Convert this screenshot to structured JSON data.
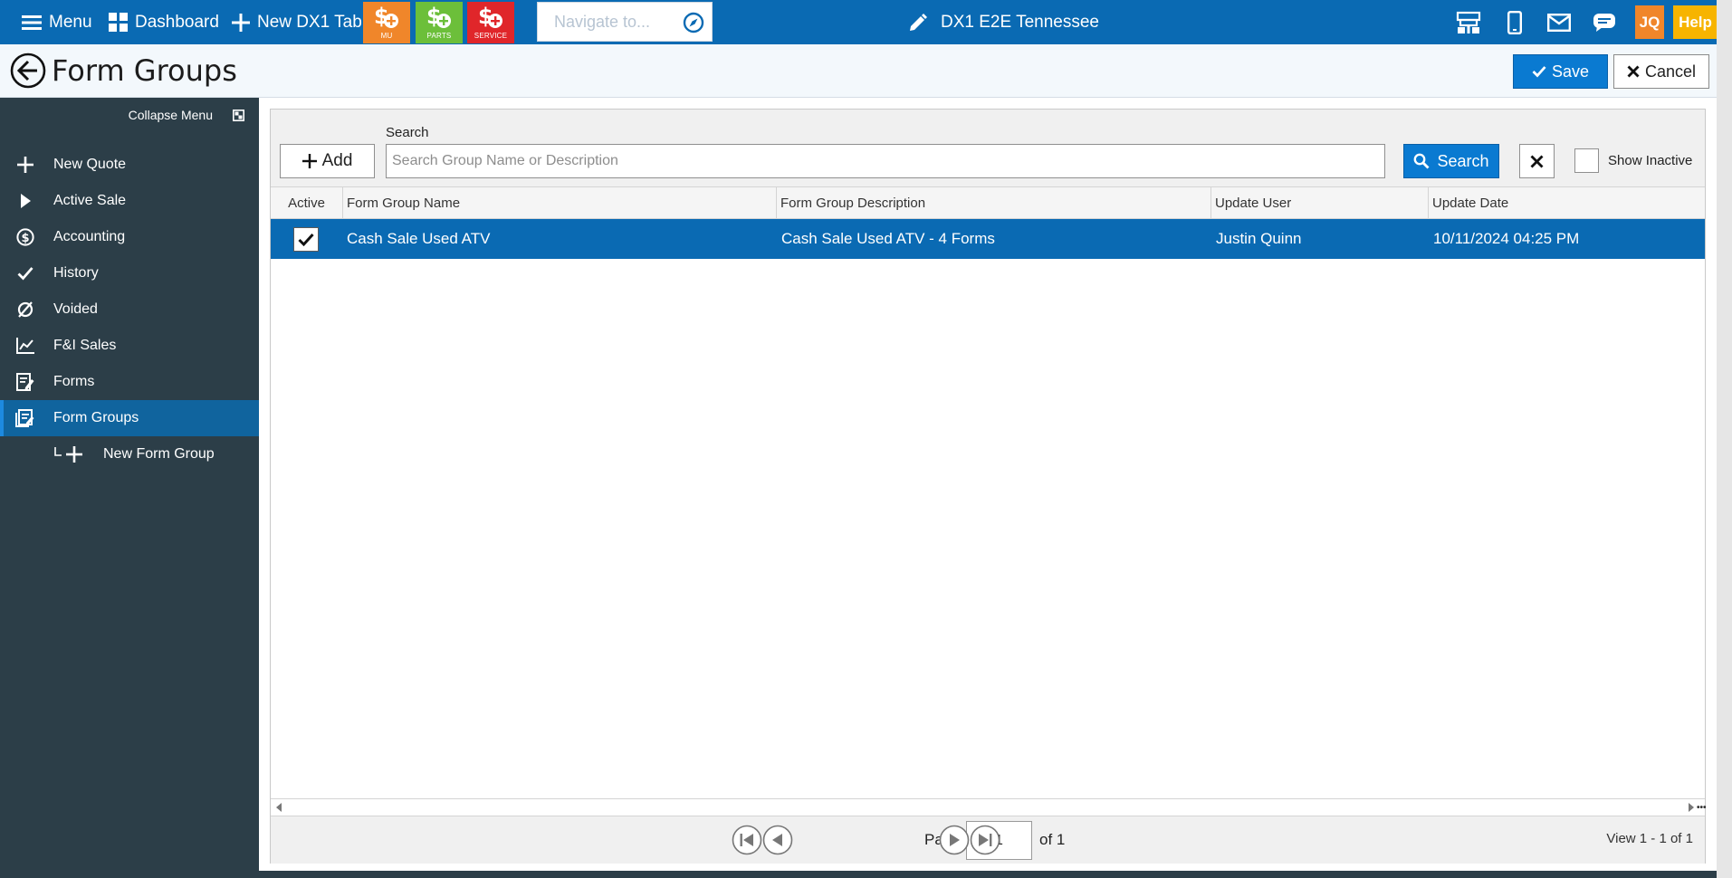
{
  "topbar": {
    "menu_label": "Menu",
    "dashboard_label": "Dashboard",
    "new_tab_label": "New DX1 Tab",
    "tiles": [
      {
        "label": "MU",
        "color": "#f0862a"
      },
      {
        "label": "PARTS",
        "color": "#6cbf3a"
      },
      {
        "label": "SERVICE",
        "color": "#e0262a"
      }
    ],
    "navigate_placeholder": "Navigate to...",
    "dealership": "DX1 E2E Tennessee",
    "user_initials": "JQ",
    "help_label": "Help",
    "icons": [
      "store-icon",
      "phone-icon",
      "mail-icon",
      "chat-icon",
      "compass-icon",
      "pencil-icon"
    ]
  },
  "page": {
    "title": "Form Groups",
    "save_label": "Save",
    "cancel_label": "Cancel"
  },
  "sidebar": {
    "collapse_label": "Collapse Menu",
    "items": [
      {
        "label": "New Quote",
        "icon": "plus-icon"
      },
      {
        "label": "Active Sale",
        "icon": "play-icon"
      },
      {
        "label": "Accounting",
        "icon": "dollar-circle-icon"
      },
      {
        "label": "History",
        "icon": "check-icon"
      },
      {
        "label": "Voided",
        "icon": "empty-set-icon"
      },
      {
        "label": "F&I Sales",
        "icon": "line-chart-icon"
      },
      {
        "label": "Forms",
        "icon": "form-edit-icon"
      },
      {
        "label": "Form Groups",
        "icon": "form-group-icon",
        "active": true
      },
      {
        "label": "New Form Group",
        "icon": "plus-icon",
        "sub": true
      }
    ]
  },
  "toolbar": {
    "add_label": "Add",
    "search_label": "Search",
    "search_placeholder": "Search Group Name or Description",
    "search_value": "",
    "search_button": "Search",
    "show_inactive_label": "Show Inactive",
    "show_inactive_checked": false
  },
  "table": {
    "columns": [
      "Active",
      "Form Group Name",
      "Form Group Description",
      "Update User",
      "Update Date"
    ],
    "rows": [
      {
        "active": true,
        "name": "Cash Sale Used ATV",
        "description": "Cash Sale Used ATV - 4 Forms",
        "user": "Justin Quinn",
        "date": "10/11/2024 04:25 PM",
        "selected": true
      }
    ]
  },
  "pager": {
    "page_label": "Page",
    "page_value": "1",
    "of_label": "of 1",
    "view_label": "View 1 - 1 of 1"
  },
  "colors": {
    "topbar": "#0a6ab3",
    "sidebar": "#2c3e48",
    "accent": "#0a7ad1",
    "selected_row": "#0a6ab3"
  }
}
